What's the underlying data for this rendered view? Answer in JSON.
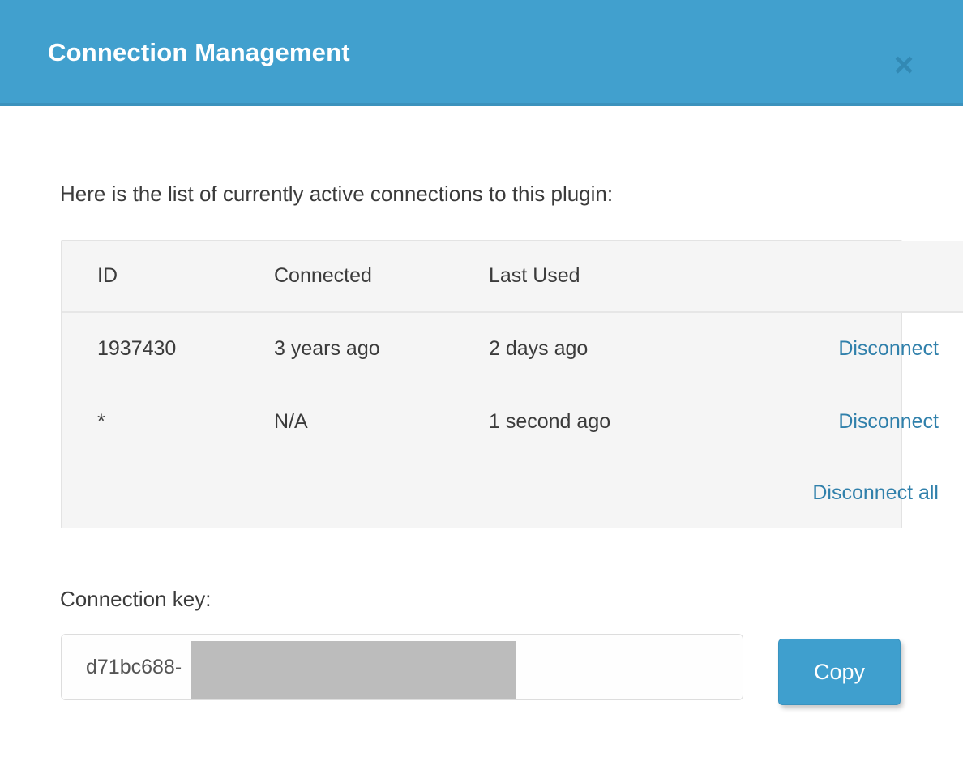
{
  "header": {
    "title": "Connection Management",
    "close_label": "×",
    "background_color": "#41a0ce",
    "border_color": "#3b92bd"
  },
  "body": {
    "intro_text": "Here is the list of currently active connections to this plugin:"
  },
  "table": {
    "columns": [
      "ID",
      "Connected",
      "Last Used",
      ""
    ],
    "rows": [
      {
        "id": "1937430",
        "connected": "3 years ago",
        "last_used": "2 days ago",
        "action": "Disconnect"
      },
      {
        "id": "*",
        "connected": "N/A",
        "last_used": "1 second ago",
        "action": "Disconnect"
      }
    ],
    "footer_action": "Disconnect all"
  },
  "connection_key": {
    "label": "Connection key:",
    "value": "d71bc688-",
    "placeholder": "",
    "redacted": true,
    "copy_button_label": "Copy"
  },
  "colors": {
    "accent": "#3f9fce",
    "link": "#3080ab",
    "text": "#3b3b3b",
    "table_background": "#f5f5f5",
    "redaction": "#bcbcbc"
  }
}
